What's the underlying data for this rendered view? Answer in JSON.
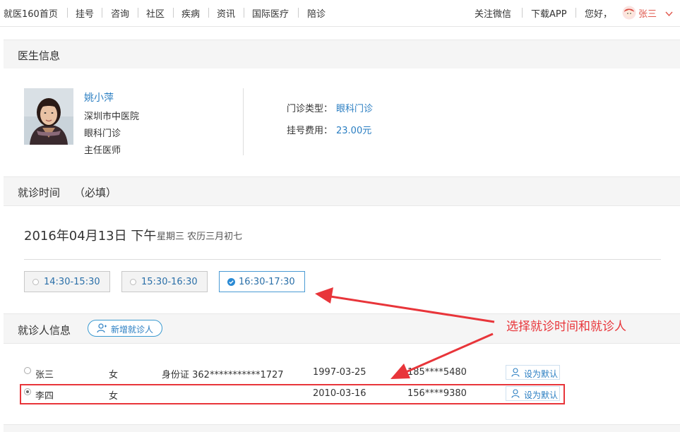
{
  "nav": {
    "items": [
      "就医160首页",
      "挂号",
      "咨询",
      "社区",
      "疾病",
      "资讯",
      "国际医疗",
      "陪诊"
    ],
    "follow_wechat": "关注微信",
    "download_app": "下载APP",
    "greeting": "您好，",
    "username": "张三"
  },
  "doctor_section": {
    "title": "医生信息",
    "name": "姚小萍",
    "hospital": "深圳市中医院",
    "department": "眼科门诊",
    "position": "主任医师",
    "clinic_type_label": "门诊类型：",
    "clinic_type_value": "眼科门诊",
    "fee_label": "挂号费用：",
    "fee_value": "23.00元"
  },
  "time_section": {
    "title": "就诊时间",
    "required": "（必填）",
    "date": "2016年04月13日 下午",
    "weekday_lunar": "星期三 农历三月初七",
    "slots": [
      {
        "label": "14:30-15:30",
        "selected": false
      },
      {
        "label": "15:30-16:30",
        "selected": false
      },
      {
        "label": "16:30-17:30",
        "selected": true
      }
    ]
  },
  "patient_section": {
    "title": "就诊人信息",
    "add_button": "新增就诊人",
    "set_default_label": "设为默认",
    "patients": [
      {
        "name": "张三",
        "gender": "女",
        "id": "身份证 362***********1727",
        "birth": "1997-03-25",
        "phone": "185****5480",
        "selected": false
      },
      {
        "name": "李四",
        "gender": "女",
        "id": "",
        "birth": "2010-03-16",
        "phone": "156****9380",
        "selected": true
      }
    ]
  },
  "annotation": {
    "text": "选择就诊时间和就诊人",
    "color": "#e8353a"
  }
}
